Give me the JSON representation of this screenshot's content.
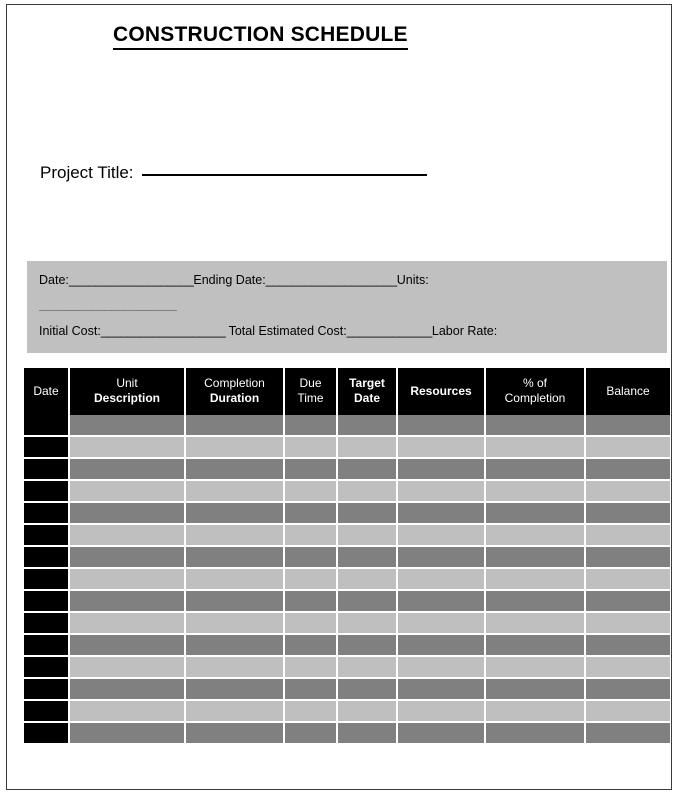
{
  "document": {
    "title": "CONSTRUCTION SCHEDULE"
  },
  "project": {
    "title_label": "Project Title:"
  },
  "info_panel": {
    "background_color": "#c0c0c0",
    "line1": {
      "date_label": "Date:",
      "date_fill": "___________________",
      "ending_date_label": "Ending Date:",
      "ending_date_fill": "____________________",
      "units_label": "Units:"
    },
    "line2": {
      "units_fill": "_____________________"
    },
    "line3": {
      "initial_cost_label": "Initial Cost:",
      "initial_cost_fill": "___________________",
      "total_estimated_cost_label": "Total Estimated Cost:",
      "total_estimated_cost_fill": "_____________",
      "labor_rate_label": "Labor Rate:"
    }
  },
  "table": {
    "header_background": "#000000",
    "header_color": "#ffffff",
    "row_color_dark": "#808080",
    "row_color_light": "#bfbfbf",
    "date_cell_color": "#000000",
    "columns": [
      {
        "line1": "Date",
        "line1_bold": false,
        "line2": "",
        "line2_bold": false
      },
      {
        "line1": "Unit",
        "line1_bold": false,
        "line2": "Description",
        "line2_bold": true
      },
      {
        "line1": "Completion",
        "line1_bold": false,
        "line2": "Duration",
        "line2_bold": true
      },
      {
        "line1": "Due",
        "line1_bold": false,
        "line2": "Time",
        "line2_bold": false
      },
      {
        "line1": "Target",
        "line1_bold": true,
        "line2": "Date",
        "line2_bold": true
      },
      {
        "line1": "Resources",
        "line1_bold": true,
        "line2": "",
        "line2_bold": false
      },
      {
        "line1": "% of",
        "line1_bold": false,
        "line2": "Completion",
        "line2_bold": false
      },
      {
        "line1": "Balance",
        "line1_bold": false,
        "line2": "",
        "line2_bold": false
      }
    ],
    "row_count": 14,
    "rows": [
      {
        "shade": "dark",
        "cells": [
          "",
          "",
          "",
          "",
          "",
          "",
          "",
          ""
        ]
      },
      {
        "shade": "light",
        "cells": [
          "",
          "",
          "",
          "",
          "",
          "",
          "",
          ""
        ]
      },
      {
        "shade": "dark",
        "cells": [
          "",
          "",
          "",
          "",
          "",
          "",
          "",
          ""
        ]
      },
      {
        "shade": "light",
        "cells": [
          "",
          "",
          "",
          "",
          "",
          "",
          "",
          ""
        ]
      },
      {
        "shade": "dark",
        "cells": [
          "",
          "",
          "",
          "",
          "",
          "",
          "",
          ""
        ]
      },
      {
        "shade": "light",
        "cells": [
          "",
          "",
          "",
          "",
          "",
          "",
          "",
          ""
        ]
      },
      {
        "shade": "dark",
        "cells": [
          "",
          "",
          "",
          "",
          "",
          "",
          "",
          ""
        ]
      },
      {
        "shade": "light",
        "cells": [
          "",
          "",
          "",
          "",
          "",
          "",
          "",
          ""
        ]
      },
      {
        "shade": "dark",
        "cells": [
          "",
          "",
          "",
          "",
          "",
          "",
          "",
          ""
        ]
      },
      {
        "shade": "light",
        "cells": [
          "",
          "",
          "",
          "",
          "",
          "",
          "",
          ""
        ]
      },
      {
        "shade": "dark",
        "cells": [
          "",
          "",
          "",
          "",
          "",
          "",
          "",
          ""
        ]
      },
      {
        "shade": "light",
        "cells": [
          "",
          "",
          "",
          "",
          "",
          "",
          "",
          ""
        ]
      },
      {
        "shade": "dark",
        "cells": [
          "",
          "",
          "",
          "",
          "",
          "",
          "",
          ""
        ]
      },
      {
        "shade": "light",
        "cells": [
          "",
          "",
          "",
          "",
          "",
          "",
          "",
          ""
        ]
      },
      {
        "shade": "dark",
        "cells": [
          "",
          "",
          "",
          "",
          "",
          "",
          "",
          ""
        ]
      }
    ]
  }
}
